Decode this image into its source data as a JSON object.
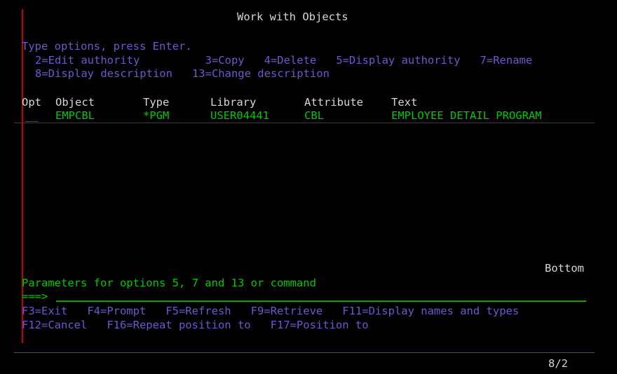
{
  "terminal": {
    "title": "Work with Objects",
    "colors": {
      "background": "#000000",
      "white": "#d6d6d6",
      "blue": "#6a5acd",
      "green": "#00c800",
      "red": "#c80000",
      "rule_blue": "#4b42b5"
    }
  },
  "instructions": {
    "prompt": "Type options, press Enter.",
    "options_line1": "2=Edit authority          3=Copy   4=Delete   5=Display authority   7=Rename",
    "options_line2": "8=Display description   13=Change description",
    "options": [
      {
        "code": "2",
        "label": "Edit authority"
      },
      {
        "code": "3",
        "label": "Copy"
      },
      {
        "code": "4",
        "label": "Delete"
      },
      {
        "code": "5",
        "label": "Display authority"
      },
      {
        "code": "7",
        "label": "Rename"
      },
      {
        "code": "8",
        "label": "Display description"
      },
      {
        "code": "13",
        "label": "Change description"
      }
    ]
  },
  "table": {
    "headers": {
      "opt": "Opt",
      "object": "Object",
      "type": "Type",
      "library": "Library",
      "attribute": "Attribute",
      "text": "Text"
    },
    "rows": [
      {
        "opt": "",
        "opt_placeholder": "__",
        "object": "EMPCBL",
        "type": "*PGM",
        "library": "USER04441",
        "attribute": "CBL",
        "text": "EMPLOYEE DETAIL PROGRAM"
      }
    ]
  },
  "status": {
    "more_indicator": "Bottom"
  },
  "command": {
    "label": "Parameters for options 5, 7 and 13 or command",
    "prompt": "===>",
    "value": "",
    "placeholder": ""
  },
  "function_keys": {
    "line1": "F3=Exit   F4=Prompt   F5=Refresh   F9=Retrieve   F11=Display names and types",
    "line2": "F12=Cancel   F16=Repeat position to   F17=Position to",
    "keys": [
      {
        "key": "F3",
        "label": "Exit"
      },
      {
        "key": "F4",
        "label": "Prompt"
      },
      {
        "key": "F5",
        "label": "Refresh"
      },
      {
        "key": "F9",
        "label": "Retrieve"
      },
      {
        "key": "F11",
        "label": "Display names and types"
      },
      {
        "key": "F12",
        "label": "Cancel"
      },
      {
        "key": "F16",
        "label": "Repeat position to"
      },
      {
        "key": "F17",
        "label": "Position to"
      }
    ]
  },
  "operator_information_area": {
    "cursor_position": "8/2"
  }
}
